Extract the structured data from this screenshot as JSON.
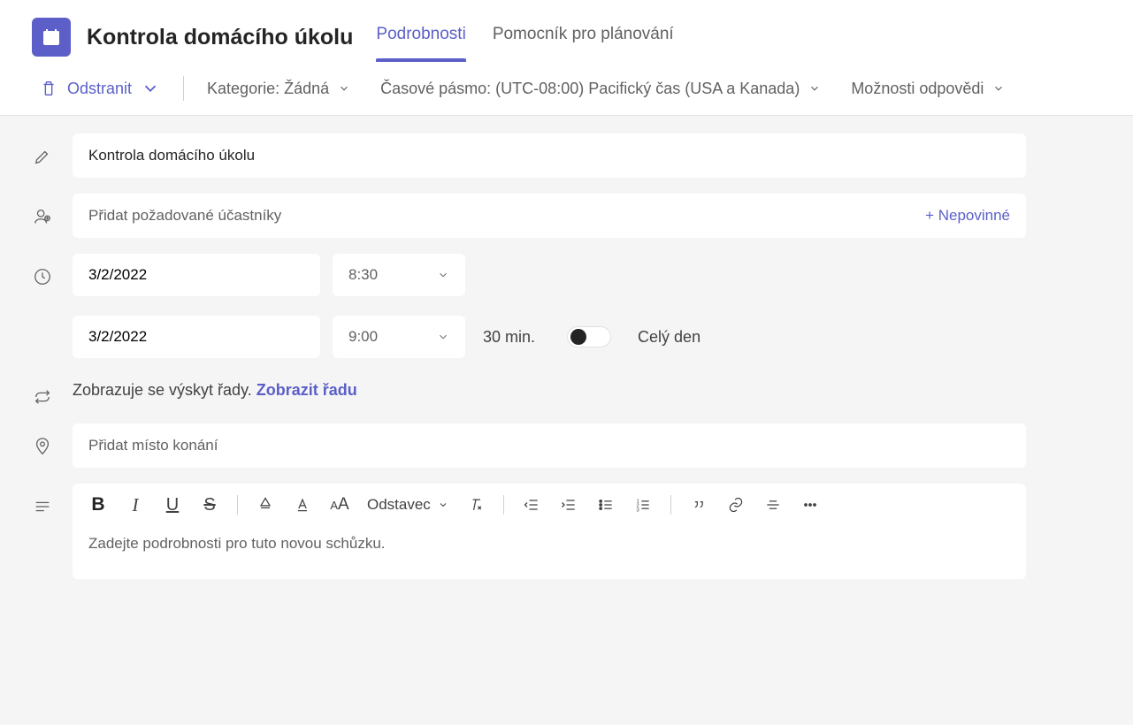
{
  "header": {
    "title": "Kontrola domácího úkolu",
    "tabs": [
      {
        "label": "Podrobnosti",
        "active": true
      },
      {
        "label": "Pomocník pro plánování",
        "active": false
      }
    ]
  },
  "toolbar": {
    "delete_label": "Odstranit",
    "category_label": "Kategorie: Žádná",
    "timezone_label": "Časové pásmo: (UTC-08:00) Pacifický čas (USA a Kanada)",
    "response_label": "Možnosti odpovědi"
  },
  "form": {
    "title_value": "Kontrola domácího úkolu",
    "attendees_placeholder": "Přidat požadované účastníky",
    "optional_label": "+ Nepovinné",
    "start_date": "3/2/2022",
    "start_time": "8:30",
    "end_date": "3/2/2022",
    "end_time": "9:00",
    "duration_label": "30 min.",
    "allday_label": "Celý den",
    "recurrence_text": "Zobrazuje se výskyt řady. ",
    "recurrence_link": "Zobrazit řadu",
    "location_placeholder": "Přidat místo konání",
    "paragraph_label": "Odstavec",
    "editor_placeholder": "Zadejte podrobnosti pro tuto novou schůzku."
  }
}
